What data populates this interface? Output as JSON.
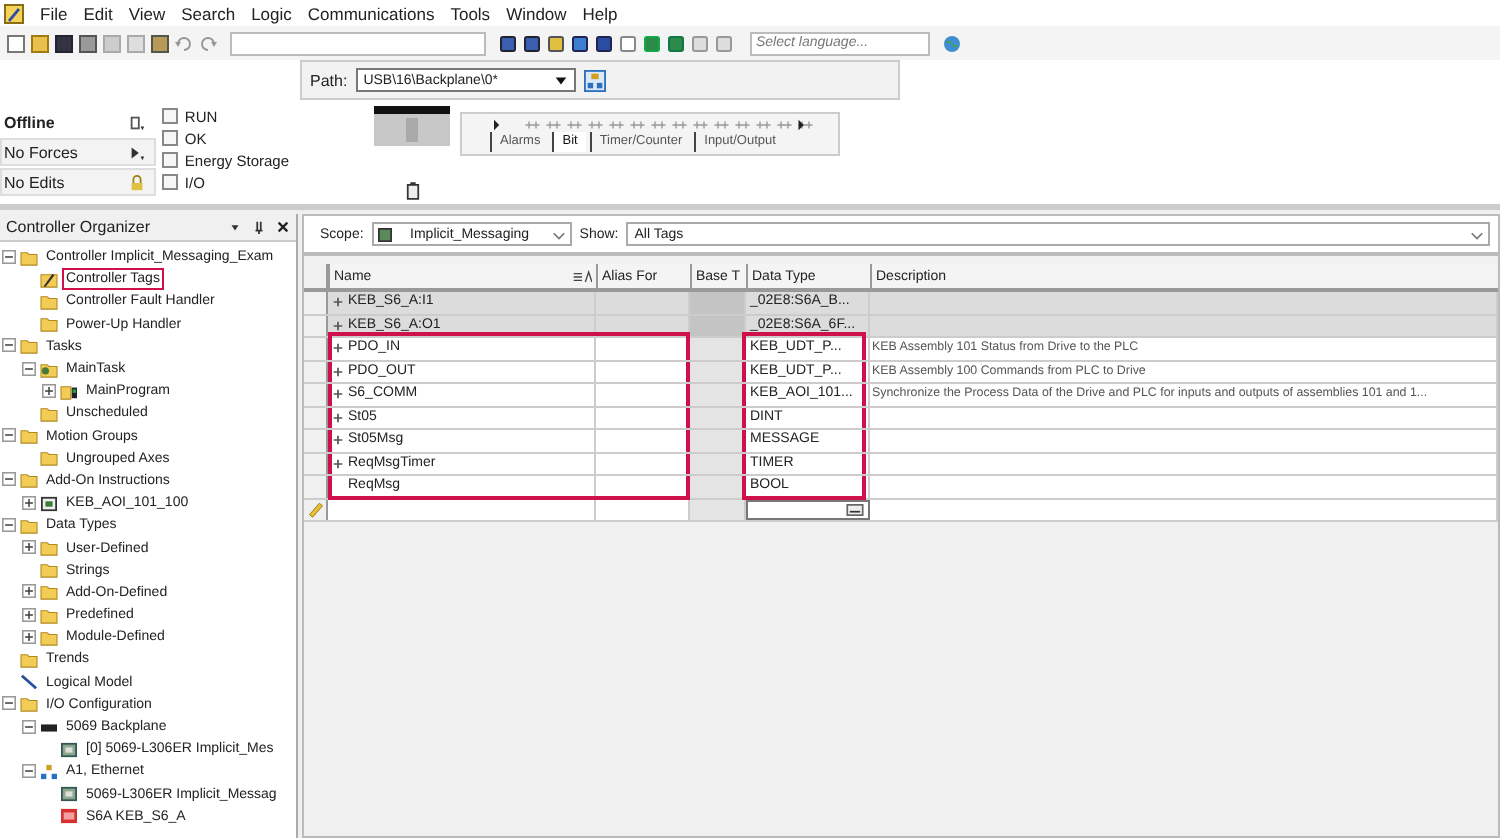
{
  "menu": [
    "File",
    "Edit",
    "View",
    "Search",
    "Logic",
    "Communications",
    "Tools",
    "Window",
    "Help"
  ],
  "toolbar": {
    "language": {
      "placeholder": "Select language..."
    }
  },
  "path": {
    "label": "Path:",
    "value": "USB\\16\\Backplane\\0*"
  },
  "controller_status": [
    {
      "label": "Offline",
      "kind": "mode"
    },
    {
      "label": "No Forces",
      "kind": "forces"
    },
    {
      "label": "No Edits",
      "kind": "edits"
    }
  ],
  "indicators": [
    {
      "label": "RUN",
      "on": false
    },
    {
      "label": "OK",
      "on": false
    },
    {
      "label": "Energy Storage",
      "on": false
    },
    {
      "label": "I/O",
      "on": false
    }
  ],
  "instruction_tabs": [
    {
      "label": "Alarms",
      "selected": false
    },
    {
      "label": "Bit",
      "selected": true
    },
    {
      "label": "Timer/Counter",
      "selected": false
    },
    {
      "label": "Input/Output",
      "selected": false
    }
  ],
  "organizer": {
    "title": "Controller Organizer",
    "tree": [
      {
        "label": "Controller Implicit_Messaging_Exam",
        "kind": "folder",
        "expanded": true,
        "children": [
          {
            "label": "Controller Tags",
            "kind": "tags",
            "highlighted": true
          },
          {
            "label": "Controller Fault Handler",
            "kind": "folder"
          },
          {
            "label": "Power-Up Handler",
            "kind": "folder"
          }
        ]
      },
      {
        "label": "Tasks",
        "kind": "folder",
        "expanded": true,
        "children": [
          {
            "label": "MainTask",
            "kind": "task",
            "expanded": true,
            "children": [
              {
                "label": "MainProgram",
                "kind": "program",
                "expanded": false
              }
            ]
          },
          {
            "label": "Unscheduled",
            "kind": "folder"
          }
        ]
      },
      {
        "label": "Motion Groups",
        "kind": "folder",
        "expanded": true,
        "children": [
          {
            "label": "Ungrouped Axes",
            "kind": "folder"
          }
        ]
      },
      {
        "label": "Add-On Instructions",
        "kind": "folder",
        "expanded": true,
        "children": [
          {
            "label": "KEB_AOI_101_100",
            "kind": "aoi",
            "expanded": false
          }
        ]
      },
      {
        "label": "Data Types",
        "kind": "folder",
        "expanded": true,
        "children": [
          {
            "label": "User-Defined",
            "kind": "folder",
            "expanded": false
          },
          {
            "label": "Strings",
            "kind": "folder"
          },
          {
            "label": "Add-On-Defined",
            "kind": "folder",
            "expanded": false
          },
          {
            "label": "Predefined",
            "kind": "folder",
            "expanded": false
          },
          {
            "label": "Module-Defined",
            "kind": "folder",
            "expanded": false
          }
        ]
      },
      {
        "label": "Trends",
        "kind": "folder"
      },
      {
        "label": "Logical Model",
        "kind": "logic"
      },
      {
        "label": "I/O Configuration",
        "kind": "folder",
        "expanded": true,
        "children": [
          {
            "label": "5069 Backplane",
            "kind": "backplane",
            "expanded": true,
            "children": [
              {
                "label": "[0] 5069-L306ER Implicit_Mes",
                "kind": "module"
              }
            ]
          },
          {
            "label": "A1, Ethernet",
            "kind": "network",
            "expanded": true,
            "children": [
              {
                "label": "5069-L306ER Implicit_Messag",
                "kind": "module"
              },
              {
                "label": "S6A KEB_S6_A",
                "kind": "device"
              }
            ]
          }
        ]
      }
    ]
  },
  "tag_editor": {
    "scope": {
      "label": "Scope:",
      "value": "Implicit_Messaging"
    },
    "show": {
      "label": "Show:",
      "value": "All Tags"
    },
    "table": {
      "columns": [
        "Name",
        "Alias For",
        "Base T",
        "Data Type",
        "Description"
      ],
      "rows": [
        {
          "name": "KEB_S6_A:I1",
          "expandable": true,
          "readonly": true,
          "highlighted": false,
          "data_type": "_02E8:S6A_B...",
          "description": ""
        },
        {
          "name": "KEB_S6_A:O1",
          "expandable": true,
          "readonly": true,
          "highlighted": false,
          "data_type": "_02E8:S6A_6F...",
          "description": ""
        },
        {
          "name": "PDO_IN",
          "expandable": true,
          "readonly": false,
          "highlighted": true,
          "data_type": "KEB_UDT_P...",
          "description": "KEB Assembly 101 Status from Drive to the PLC"
        },
        {
          "name": "PDO_OUT",
          "expandable": true,
          "readonly": false,
          "highlighted": true,
          "data_type": "KEB_UDT_P...",
          "description": "KEB Assembly 100 Commands from PLC to Drive"
        },
        {
          "name": "S6_COMM",
          "expandable": true,
          "readonly": false,
          "highlighted": true,
          "data_type": "KEB_AOI_101...",
          "description": "Synchronize the Process Data of the Drive and PLC for inputs and outputs of assemblies 101 and 1..."
        },
        {
          "name": "St05",
          "expandable": true,
          "readonly": false,
          "highlighted": true,
          "data_type": "DINT",
          "description": ""
        },
        {
          "name": "St05Msg",
          "expandable": true,
          "readonly": false,
          "highlighted": true,
          "data_type": "MESSAGE",
          "description": ""
        },
        {
          "name": "ReqMsgTimer",
          "expandable": true,
          "readonly": false,
          "highlighted": true,
          "data_type": "TIMER",
          "description": ""
        },
        {
          "name": "ReqMsg",
          "expandable": false,
          "readonly": false,
          "highlighted": true,
          "data_type": "BOOL",
          "description": ""
        }
      ]
    }
  }
}
